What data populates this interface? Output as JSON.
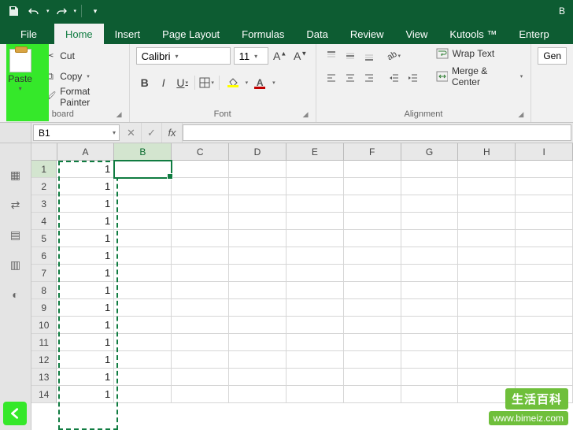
{
  "titlebar": {
    "right_text": "B"
  },
  "tabs": {
    "file": "File",
    "items": [
      "Home",
      "Insert",
      "Page Layout",
      "Formulas",
      "Data",
      "Review",
      "View",
      "Kutools ™",
      "Enterp"
    ],
    "active_index": 0
  },
  "ribbon": {
    "clipboard": {
      "paste_label": "Paste",
      "cut_label": "Cut",
      "copy_label": "Copy",
      "format_painter_label": "Format Painter",
      "group_label": "board"
    },
    "font": {
      "font_name": "Calibri",
      "font_size": "11",
      "group_label": "Font"
    },
    "alignment": {
      "wrap_label": "Wrap Text",
      "merge_label": "Merge & Center",
      "group_label": "Alignment"
    },
    "number": {
      "format": "Gen"
    }
  },
  "formula_bar": {
    "name_box": "B1",
    "formula": ""
  },
  "sheet": {
    "columns": [
      "A",
      "B",
      "C",
      "D",
      "E",
      "F",
      "G",
      "H",
      "I"
    ],
    "selected_col": "B",
    "active_cell": "B1",
    "copy_range_col": "A",
    "rows": [
      {
        "n": 1,
        "A": "1"
      },
      {
        "n": 2,
        "A": "1"
      },
      {
        "n": 3,
        "A": "1"
      },
      {
        "n": 4,
        "A": "1"
      },
      {
        "n": 5,
        "A": "1"
      },
      {
        "n": 6,
        "A": "1"
      },
      {
        "n": 7,
        "A": "1"
      },
      {
        "n": 8,
        "A": "1"
      },
      {
        "n": 9,
        "A": "1"
      },
      {
        "n": 10,
        "A": "1"
      },
      {
        "n": 11,
        "A": "1"
      },
      {
        "n": 12,
        "A": "1"
      },
      {
        "n": 13,
        "A": "1"
      },
      {
        "n": 14,
        "A": "1"
      }
    ]
  },
  "overlay": {
    "badge1": "生活百科",
    "badge2": "www.bimeiz.com"
  }
}
